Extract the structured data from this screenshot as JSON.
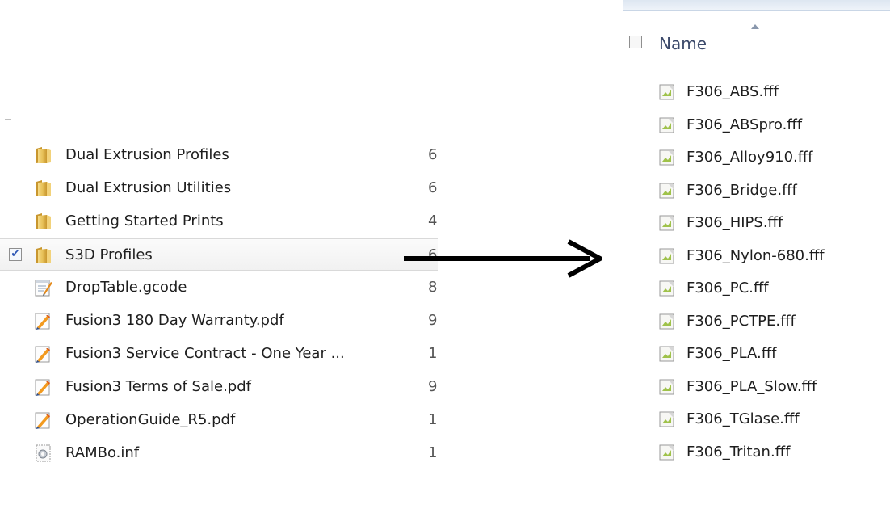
{
  "left_list": {
    "items": [
      {
        "name": "Dual Extrusion Profiles",
        "size": "6",
        "icon": "folder-icon",
        "checked": false,
        "selected": false
      },
      {
        "name": "Dual Extrusion Utilities",
        "size": "6",
        "icon": "folder-icon",
        "checked": false,
        "selected": false
      },
      {
        "name": "Getting Started Prints",
        "size": "4",
        "icon": "folder-icon",
        "checked": false,
        "selected": false
      },
      {
        "name": "S3D Profiles",
        "size": "6",
        "icon": "folder-icon",
        "checked": true,
        "selected": true
      },
      {
        "name": "DropTable.gcode",
        "size": "8",
        "icon": "gcode-file-icon",
        "checked": false,
        "selected": false
      },
      {
        "name": "Fusion3 180 Day Warranty.pdf",
        "size": "9",
        "icon": "pdf-file-icon",
        "checked": false,
        "selected": false
      },
      {
        "name": "Fusion3 Service Contract  - One Year ...",
        "size": "1",
        "icon": "pdf-file-icon",
        "checked": false,
        "selected": false
      },
      {
        "name": "Fusion3 Terms of Sale.pdf",
        "size": "9",
        "icon": "pdf-file-icon",
        "checked": false,
        "selected": false
      },
      {
        "name": "OperationGuide_R5.pdf",
        "size": "1",
        "icon": "pdf-file-icon",
        "checked": false,
        "selected": false
      },
      {
        "name": "RAMBo.inf",
        "size": "1",
        "icon": "setup-info-file-icon",
        "checked": false,
        "selected": false
      }
    ]
  },
  "right_list": {
    "header_name": "Name",
    "items": [
      {
        "name": "F306_ABS.fff",
        "icon": "fff-file-icon"
      },
      {
        "name": "F306_ABSpro.fff",
        "icon": "fff-file-icon"
      },
      {
        "name": "F306_Alloy910.fff",
        "icon": "fff-file-icon"
      },
      {
        "name": "F306_Bridge.fff",
        "icon": "fff-file-icon"
      },
      {
        "name": "F306_HIPS.fff",
        "icon": "fff-file-icon"
      },
      {
        "name": "F306_Nylon-680.fff",
        "icon": "fff-file-icon"
      },
      {
        "name": "F306_PC.fff",
        "icon": "fff-file-icon"
      },
      {
        "name": "F306_PCTPE.fff",
        "icon": "fff-file-icon"
      },
      {
        "name": "F306_PLA.fff",
        "icon": "fff-file-icon"
      },
      {
        "name": "F306_PLA_Slow.fff",
        "icon": "fff-file-icon"
      },
      {
        "name": "F306_TGlase.fff",
        "icon": "fff-file-icon"
      },
      {
        "name": "F306_Tritan.fff",
        "icon": "fff-file-icon"
      }
    ]
  },
  "colors": {
    "folder": "#e8c25a",
    "arrow": "#000000",
    "header_text": "#3c4a6b",
    "checkmark": "#2a55b5"
  }
}
